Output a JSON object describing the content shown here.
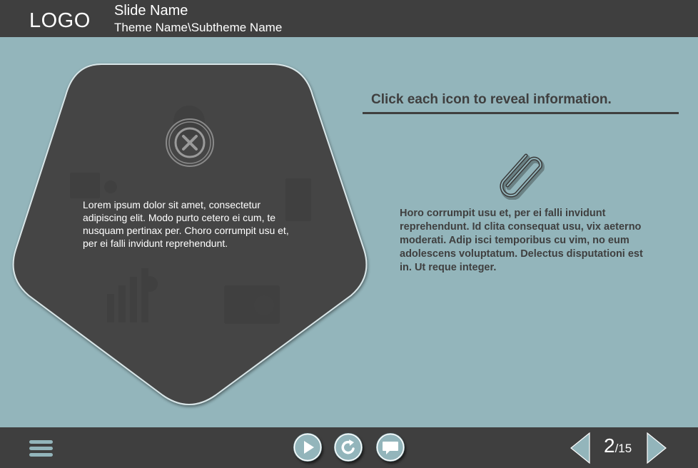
{
  "header": {
    "logo": "LOGO",
    "slide_name": "Slide Name",
    "theme_name": "Theme Name\\Subtheme Name"
  },
  "pentagon": {
    "body_text": "Lorem ipsum dolor sit amet, consectetur adipiscing elit. Modo purto cetero ei cum, te nusquam pertinax per. Choro corrumpit usu et, per ei falli invidunt reprehendunt.",
    "close_icon": "close-icon"
  },
  "panel": {
    "instruction": "Click each icon to reveal information.",
    "icon": "paperclip-icon",
    "info_text": "Horo corrumpit usu et, per ei falli invidunt reprehendunt. Id clita consequat usu, vix aeterno moderati. Adip isci temporibus cu vim, no eum adolescens voluptatum. Delectus disputationi est in. Ut reque integer."
  },
  "footer": {
    "menu_icon": "hamburger-menu-icon",
    "play_icon": "play-icon",
    "replay_icon": "replay-icon",
    "comment_icon": "comment-icon",
    "prev_icon": "arrow-left-icon",
    "next_icon": "arrow-right-icon",
    "current_page": "2",
    "total_pages": "/15"
  },
  "colors": {
    "background": "#93b5bb",
    "bars": "#3f3f3f",
    "pentagon": "#454545",
    "text_dark": "#3f3f3f",
    "text_light": "#ffffff"
  }
}
